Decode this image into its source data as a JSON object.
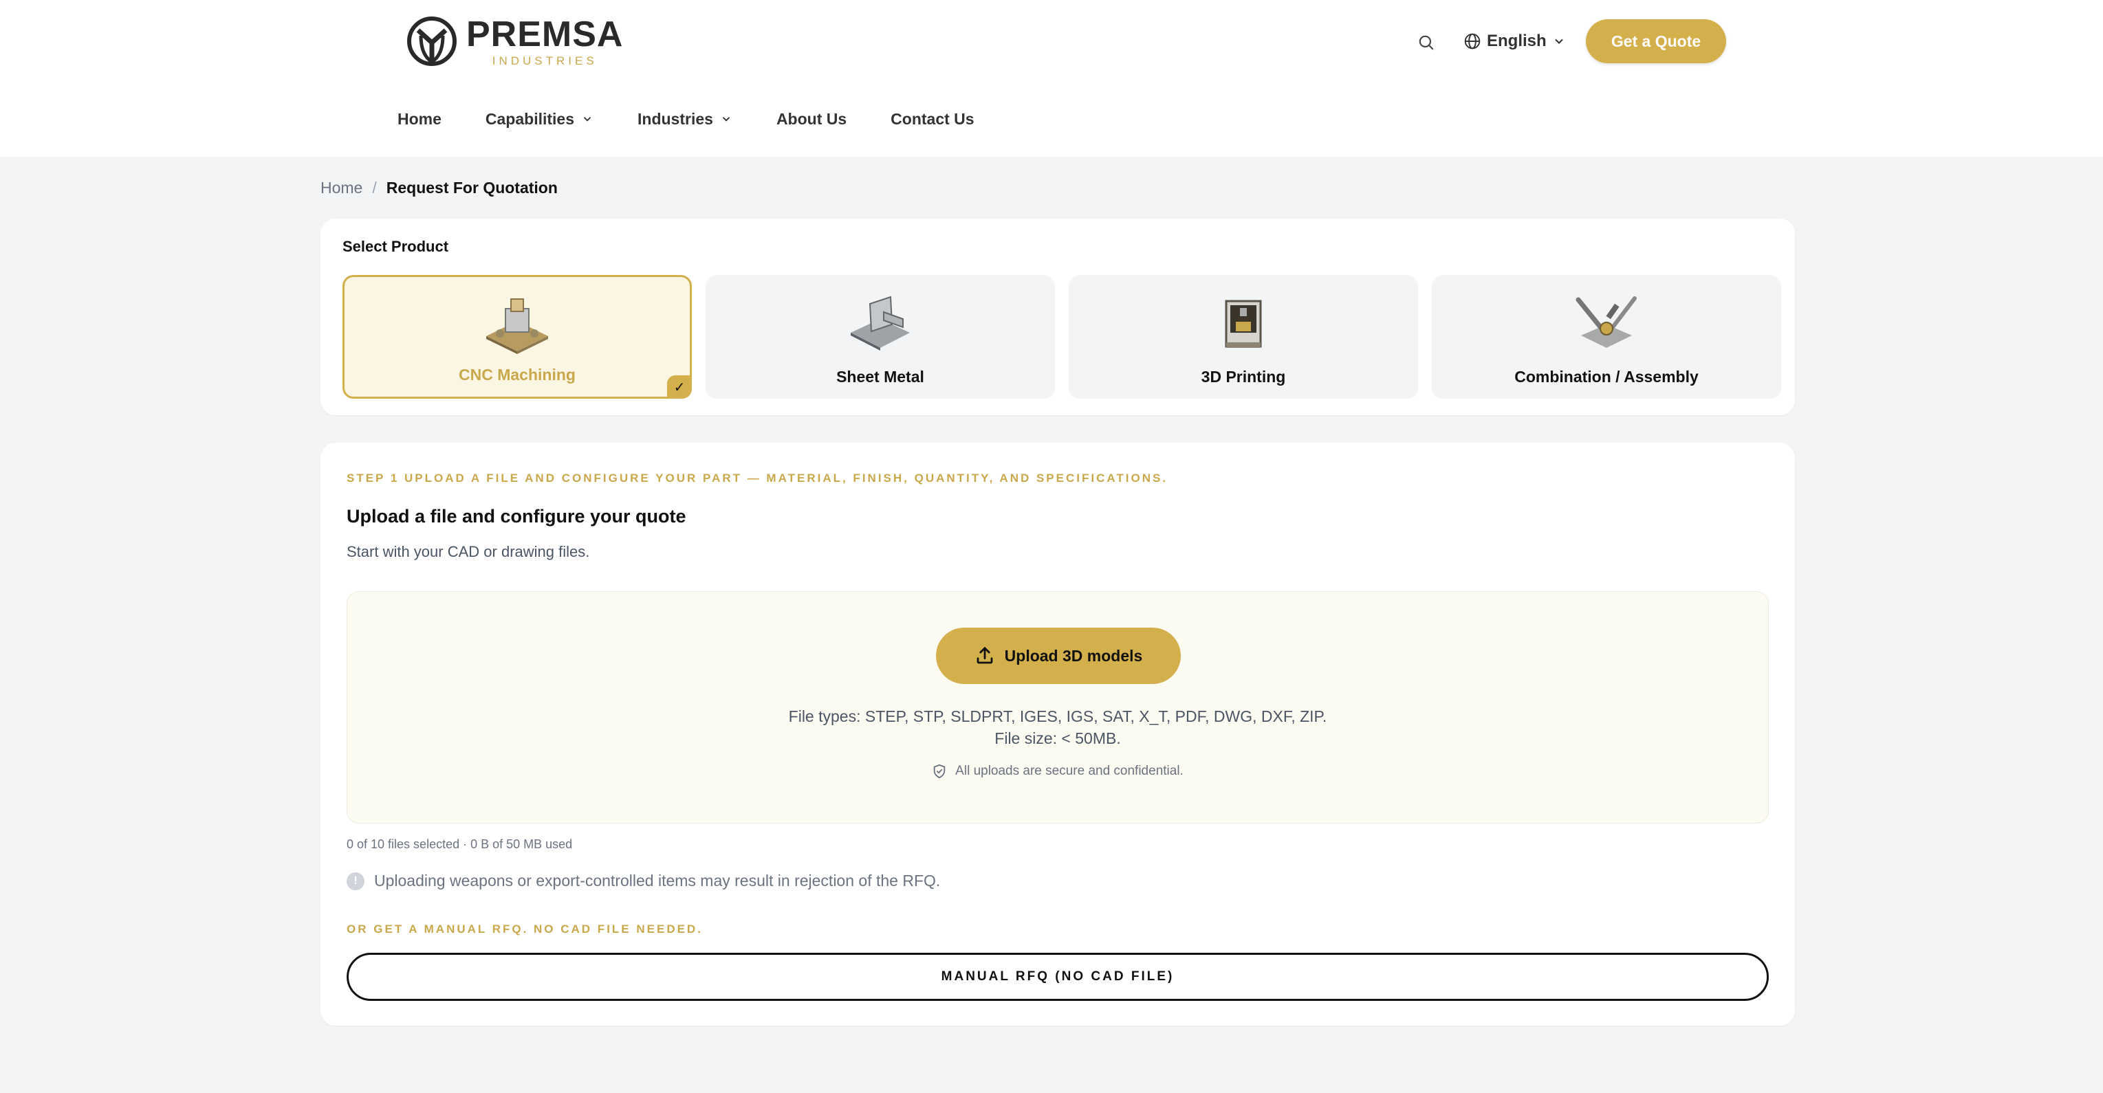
{
  "brand": {
    "name": "PREMSA",
    "tagline": "INDUSTRIES"
  },
  "header": {
    "language": "English",
    "quote_button": "Get a Quote",
    "nav": [
      {
        "label": "Home",
        "has_dropdown": false
      },
      {
        "label": "Capabilities",
        "has_dropdown": true
      },
      {
        "label": "Industries",
        "has_dropdown": true
      },
      {
        "label": "About Us",
        "has_dropdown": false
      },
      {
        "label": "Contact Us",
        "has_dropdown": false
      }
    ]
  },
  "breadcrumb": {
    "home": "Home",
    "separator": "/",
    "current": "Request For Quotation"
  },
  "product_select": {
    "title": "Select Product",
    "products": [
      {
        "label": "CNC Machining",
        "selected": true,
        "icon": "cnc-machining-icon"
      },
      {
        "label": "Sheet Metal",
        "selected": false,
        "icon": "sheet-metal-icon"
      },
      {
        "label": "3D Printing",
        "selected": false,
        "icon": "3d-printer-icon"
      },
      {
        "label": "Combination / Assembly",
        "selected": false,
        "icon": "assembly-tools-icon"
      }
    ],
    "check_mark": "✓"
  },
  "step": {
    "label": "STEP 1 UPLOAD A FILE AND CONFIGURE YOUR PART — MATERIAL, FINISH, QUANTITY, AND SPECIFICATIONS.",
    "title": "Upload a file and configure your quote",
    "subtitle": "Start with your CAD or drawing files.",
    "upload_button": "Upload 3D models",
    "file_types": "File types: STEP, STP, SLDPRT, IGES, IGS, SAT, X_T, PDF, DWG, DXF, ZIP.",
    "file_size": "File size: < 50MB.",
    "secure_note": "All uploads are secure and confidential.",
    "files_count": "0 of 10 files selected · 0 B of 50 MB used",
    "warning": "Uploading weapons or export-controlled items may result in rejection of the RFQ.",
    "info_symbol": "!",
    "manual_label": "OR GET A MANUAL RFQ. NO CAD FILE NEEDED.",
    "manual_button": "MANUAL RFQ (NO CAD FILE)"
  },
  "colors": {
    "accent": "#d4b04d",
    "accent_text": "#c9a84c",
    "page_bg": "#f3f4f6",
    "dropzone_bg": "#fcfbf2"
  }
}
